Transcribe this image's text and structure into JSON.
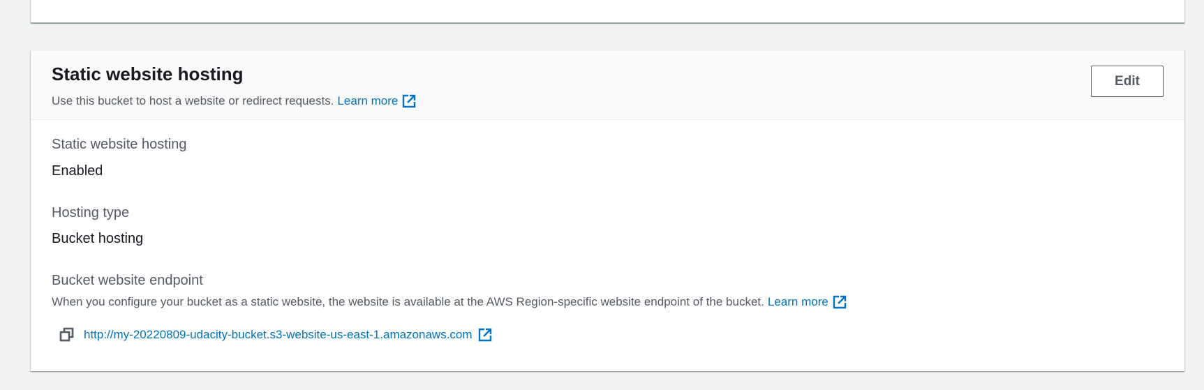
{
  "section": {
    "title": "Static website hosting",
    "description": "Use this bucket to host a website or redirect requests.",
    "learn_more": "Learn more",
    "edit_label": "Edit"
  },
  "fields": {
    "hosting": {
      "label": "Static website hosting",
      "value": "Enabled"
    },
    "hosting_type": {
      "label": "Hosting type",
      "value": "Bucket hosting"
    },
    "endpoint": {
      "label": "Bucket website endpoint",
      "description": "When you configure your bucket as a static website, the website is available at the AWS Region-specific website endpoint of the bucket.",
      "learn_more": "Learn more",
      "url": "http://my-20220809-udacity-bucket.s3-website-us-east-1.amazonaws.com"
    }
  },
  "icons": {
    "external_link": "external-link-icon",
    "copy": "copy-icon"
  },
  "colors": {
    "link": "#0073bb",
    "label": "#545b64",
    "text": "#16191f",
    "background": "#f2f3f3"
  }
}
